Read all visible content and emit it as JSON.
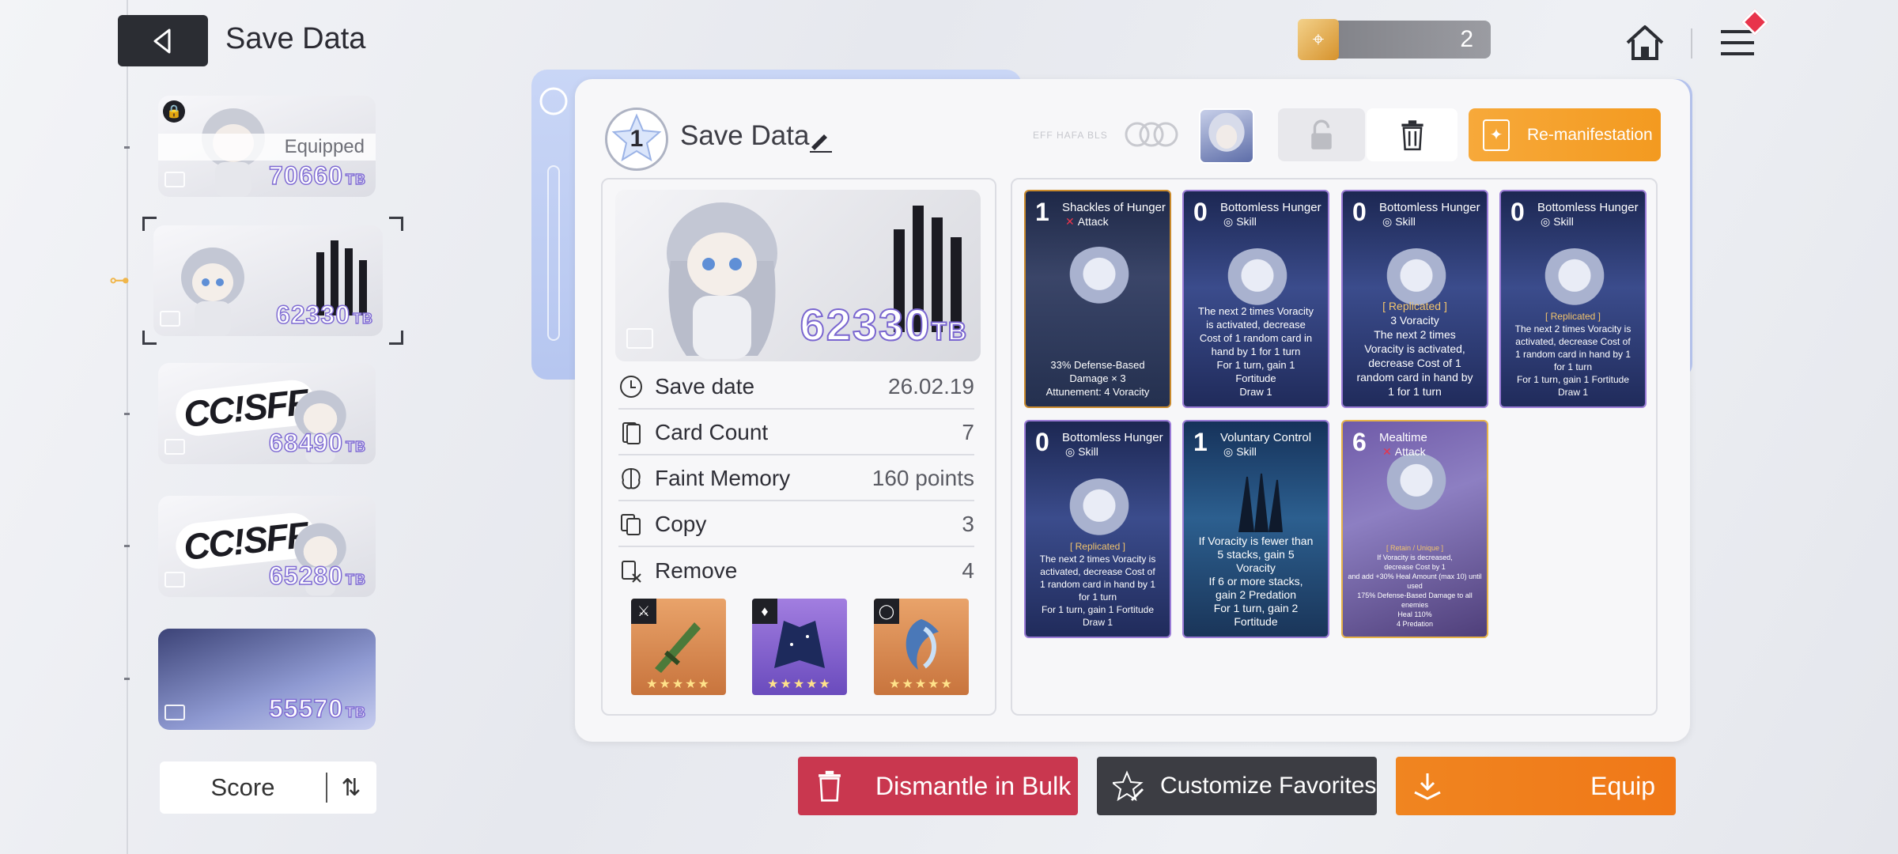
{
  "header": {
    "title": "Save Data",
    "ticket_count": "2"
  },
  "slots": [
    {
      "tb": "70660",
      "unit": "TB",
      "equipped_label": "Equipped"
    },
    {
      "tb": "62330",
      "unit": "TB"
    },
    {
      "tb": "68490",
      "unit": "TB",
      "logo": "CC!SFF"
    },
    {
      "tb": "65280",
      "unit": "TB",
      "logo": "CC!SFF"
    },
    {
      "tb": "55570",
      "unit": "TB"
    }
  ],
  "sort": {
    "label": "Score",
    "icon": "sort-toggle-icon"
  },
  "detail": {
    "level": "1",
    "name": "Save Data",
    "faint_text": "EFF HAFA BLS",
    "re_manifestation": "Re-manifestation",
    "portrait_tb": "62330",
    "portrait_unit": "TB",
    "rows": [
      {
        "label": "Save date",
        "value": "26.02.19",
        "icon": "clock-icon"
      },
      {
        "label": "Card Count",
        "value": "7",
        "icon": "cards-icon"
      },
      {
        "label": "Faint Memory",
        "value": "160 points",
        "icon": "brain-icon"
      },
      {
        "label": "Copy",
        "value": "3",
        "icon": "copy-icon"
      },
      {
        "label": "Remove",
        "value": "4",
        "icon": "remove-icon"
      }
    ],
    "equipment": [
      {
        "slot": "weapon",
        "icon": "sword-icon"
      },
      {
        "slot": "armor",
        "icon": "armor-icon"
      },
      {
        "slot": "ring",
        "icon": "ring-icon"
      }
    ]
  },
  "cards": [
    {
      "cost": "1",
      "name": "Shackles of Hunger",
      "type": "Attack",
      "kind": "attack",
      "desc": [
        "33% Defense-Based",
        "Damage × 3",
        "Attunement: 4 Voracity"
      ]
    },
    {
      "cost": "0",
      "name": "Bottomless Hunger",
      "type": "Skill",
      "kind": "skill",
      "desc": [
        "The next 2 times Voracity",
        "is activated, decrease",
        "Cost of 1 random card in",
        "hand by 1 for 1 turn",
        "For 1 turn, gain 1",
        "Fortitude",
        "Draw 1"
      ]
    },
    {
      "cost": "0",
      "name": "Bottomless Hunger",
      "type": "Skill",
      "kind": "skill",
      "replicated": "[ Replicated ]",
      "desc": [
        "3 Voracity",
        "The next 2 times",
        "Voracity is activated,",
        "decrease Cost of 1",
        "random card in hand by",
        "1 for 1 turn"
      ]
    },
    {
      "cost": "0",
      "name": "Bottomless Hunger",
      "type": "Skill",
      "kind": "skill",
      "replicated": "[ Replicated ]",
      "desc": [
        "The next 2 times Voracity is",
        "activated, decrease Cost of",
        "1 random card in hand by 1",
        "for 1 turn",
        "For 1 turn, gain 1 Fortitude",
        "Draw 1"
      ]
    },
    {
      "cost": "0",
      "name": "Bottomless Hunger",
      "type": "Skill",
      "kind": "skill",
      "replicated": "[ Replicated ]",
      "desc": [
        "The next 2 times Voracity is",
        "activated, decrease Cost of",
        "1 random card in hand by 1",
        "for 1 turn",
        "For 1 turn, gain 1 Fortitude",
        "Draw 1"
      ]
    },
    {
      "cost": "1",
      "name": "Voluntary Control",
      "type": "Skill",
      "kind": "skill",
      "desc": [
        "If Voracity is fewer than",
        "5 stacks, gain 5",
        "Voracity",
        "If 6 or more stacks,",
        "gain 2 Predation",
        "For 1 turn, gain 2",
        "Fortitude"
      ]
    },
    {
      "cost": "6",
      "name": "Mealtime",
      "type": "Attack",
      "kind": "attack",
      "replicated": "[ Retain / Unique ]",
      "desc": [
        "If Voracity is decreased,",
        "decrease Cost by 1",
        "and add +30% Heal Amount (max 10) until used",
        "175% Defense-Based Damage to all",
        "enemies",
        "Heal 110%",
        "4 Predation"
      ]
    }
  ],
  "actions": {
    "dismantle": "Dismantle in Bulk",
    "customize": "Customize Favorites",
    "equip": "Equip"
  },
  "colors": {
    "accent_orange": "#f39a20",
    "danger_red": "#c9374f",
    "tb_purple": "#7f6bd3"
  }
}
